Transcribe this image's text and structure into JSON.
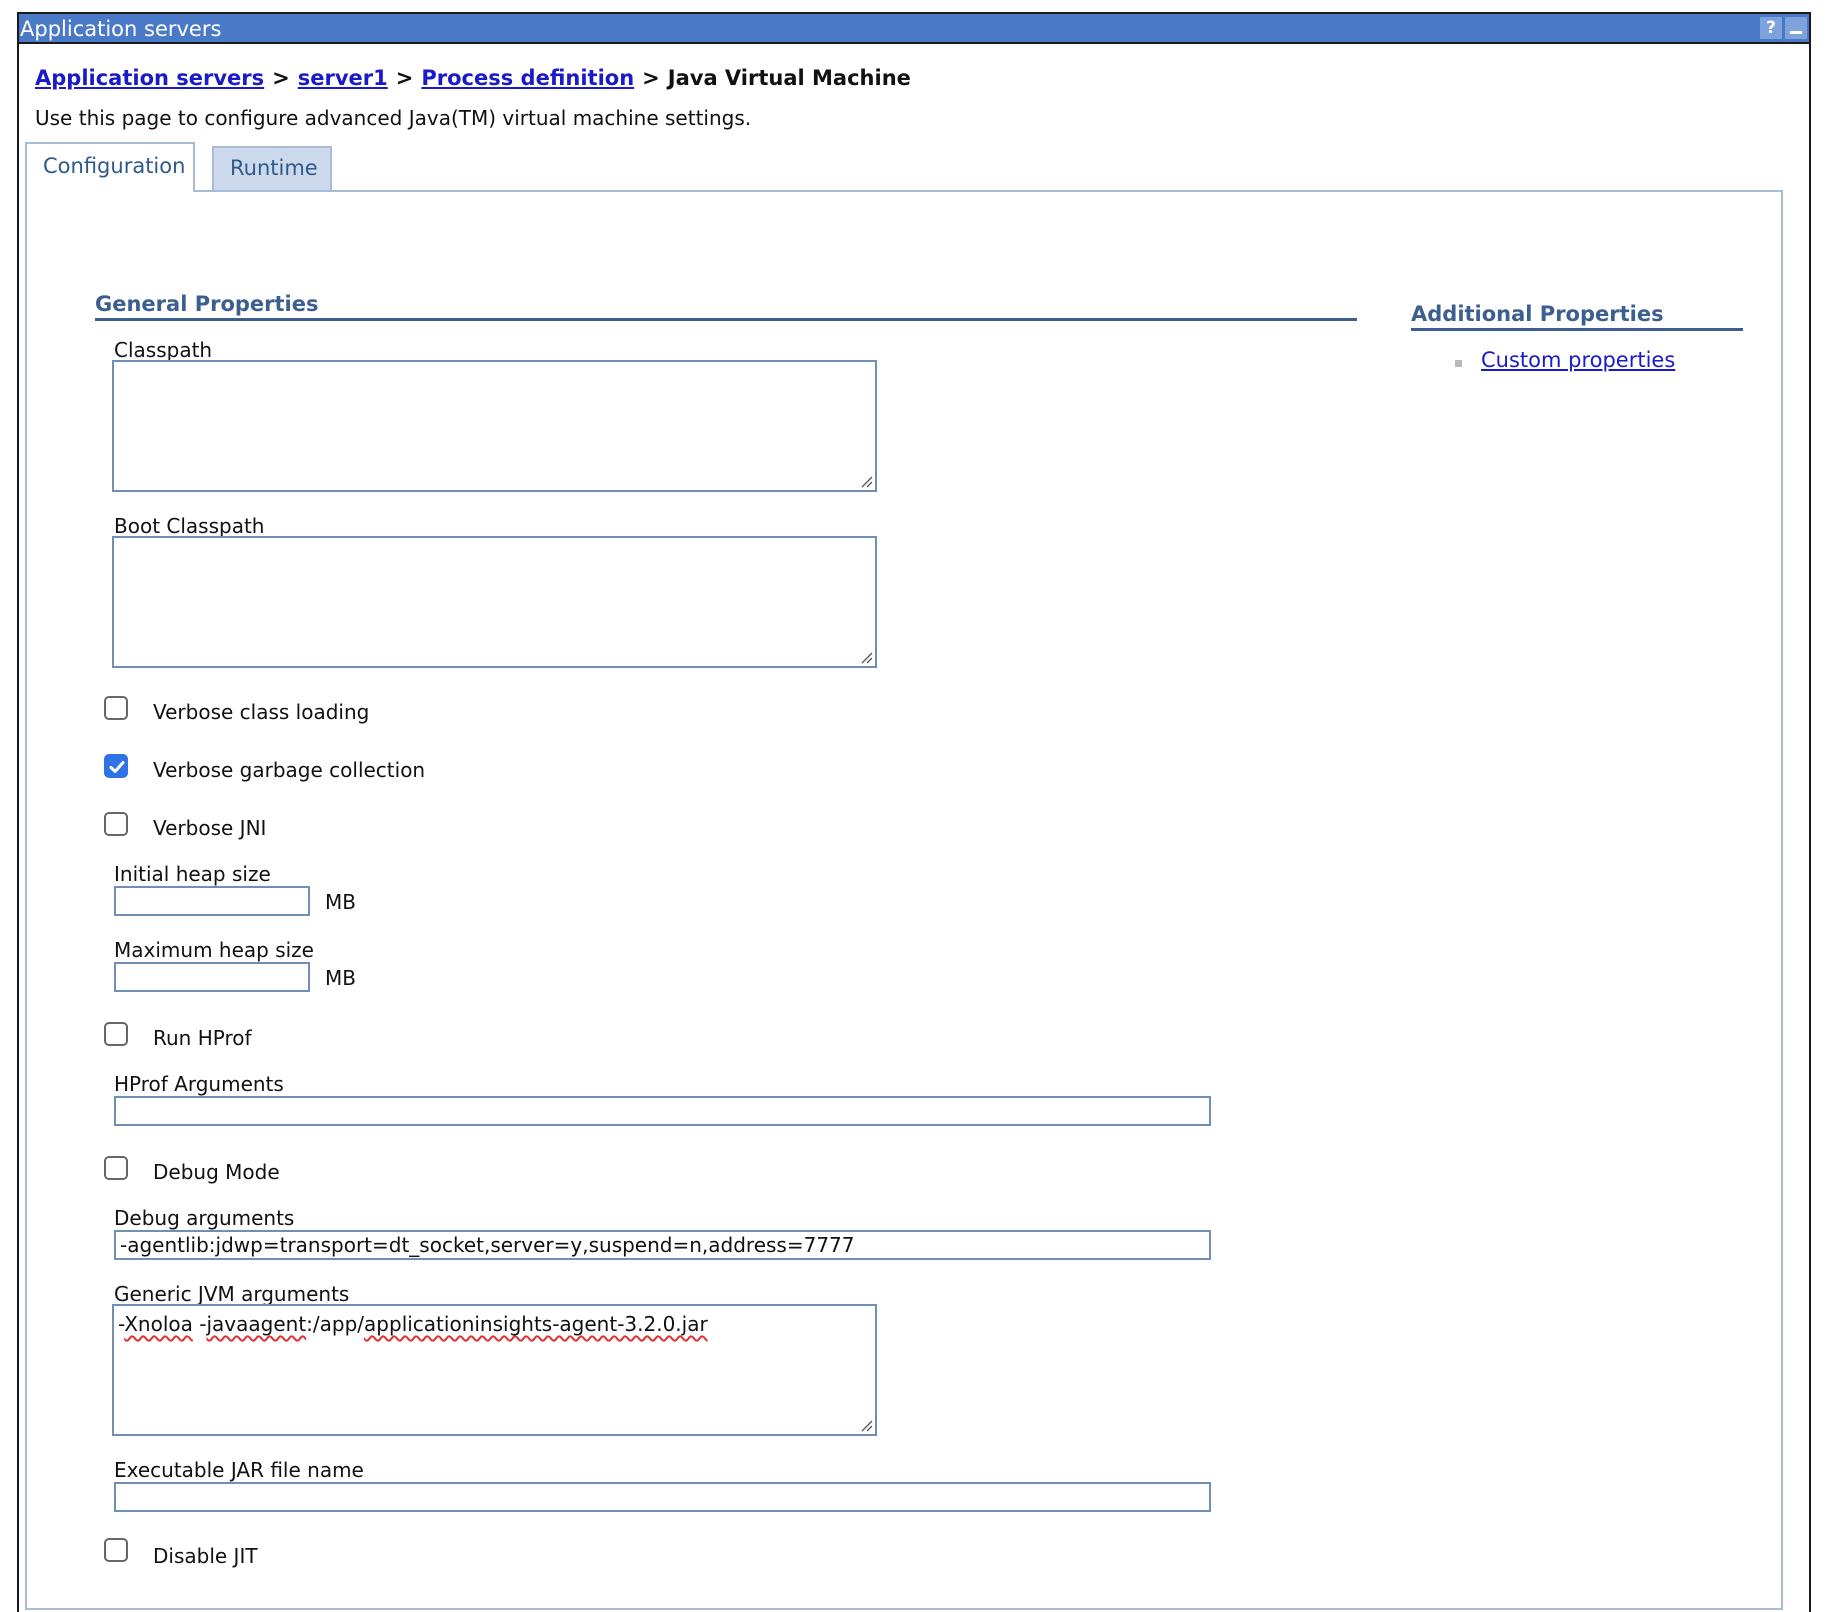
{
  "window": {
    "title": "Application servers",
    "help_icon": "?"
  },
  "breadcrumb": {
    "items": [
      "Application servers",
      "server1",
      "Process definition"
    ],
    "current": "Java Virtual Machine",
    "separator": ">"
  },
  "description": "Use this page to configure advanced Java(TM) virtual machine settings.",
  "tabs": [
    {
      "label": "Configuration",
      "active": true
    },
    {
      "label": "Runtime",
      "active": false
    }
  ],
  "general": {
    "heading": "General Properties",
    "classpath": {
      "label": "Classpath",
      "value": ""
    },
    "boot_classpath": {
      "label": "Boot Classpath",
      "value": ""
    },
    "verbose_class_loading": {
      "label": "Verbose class loading",
      "checked": false
    },
    "verbose_gc": {
      "label": "Verbose garbage collection",
      "checked": true
    },
    "verbose_jni": {
      "label": "Verbose JNI",
      "checked": false
    },
    "initial_heap": {
      "label": "Initial heap size",
      "value": "",
      "unit": "MB"
    },
    "max_heap": {
      "label": "Maximum heap size",
      "value": "",
      "unit": "MB"
    },
    "run_hprof": {
      "label": "Run HProf",
      "checked": false
    },
    "hprof_args": {
      "label": "HProf Arguments",
      "value": ""
    },
    "debug_mode": {
      "label": "Debug Mode",
      "checked": false
    },
    "debug_args": {
      "label": "Debug arguments",
      "value": "-agentlib:jdwp=transport=dt_socket,server=y,suspend=n,address=7777"
    },
    "generic_jvm": {
      "label": "Generic JVM arguments",
      "value": "-Xnoloa -javaagent:/app/applicationinsights-agent-3.2.0.jar",
      "parts": [
        "-",
        "Xnoloa",
        " -",
        "javaagent",
        ":/app/",
        "applicationinsights-agent-3.2.0.jar"
      ]
    },
    "exec_jar": {
      "label": "Executable JAR file name",
      "value": ""
    },
    "disable_jit": {
      "label": "Disable JIT",
      "checked": false
    }
  },
  "additional": {
    "heading": "Additional Properties",
    "links": [
      "Custom properties"
    ]
  },
  "colors": {
    "titlebar": "#4a7ac7",
    "link": "#1a1ac8",
    "section": "#3c5f8f",
    "checkbox_checked": "#2f73e6"
  }
}
